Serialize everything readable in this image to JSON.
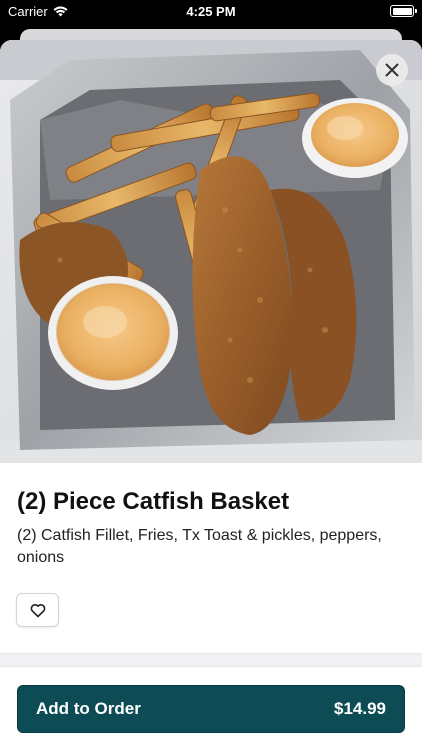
{
  "status_bar": {
    "carrier": "Carrier",
    "time": "4:25 PM"
  },
  "item": {
    "title": "(2) Piece Catfish Basket",
    "description": "(2) Catfish Fillet, Fries, Tx Toast & pickles, peppers, onions"
  },
  "order_button": {
    "label": "Add to Order",
    "price": "$14.99"
  },
  "colors": {
    "accent": "#0e4c55",
    "background": "#ffffff"
  },
  "icons": {
    "close": "close-icon",
    "favorite": "heart-outline-icon",
    "wifi": "wifi-icon",
    "battery": "battery-icon"
  }
}
